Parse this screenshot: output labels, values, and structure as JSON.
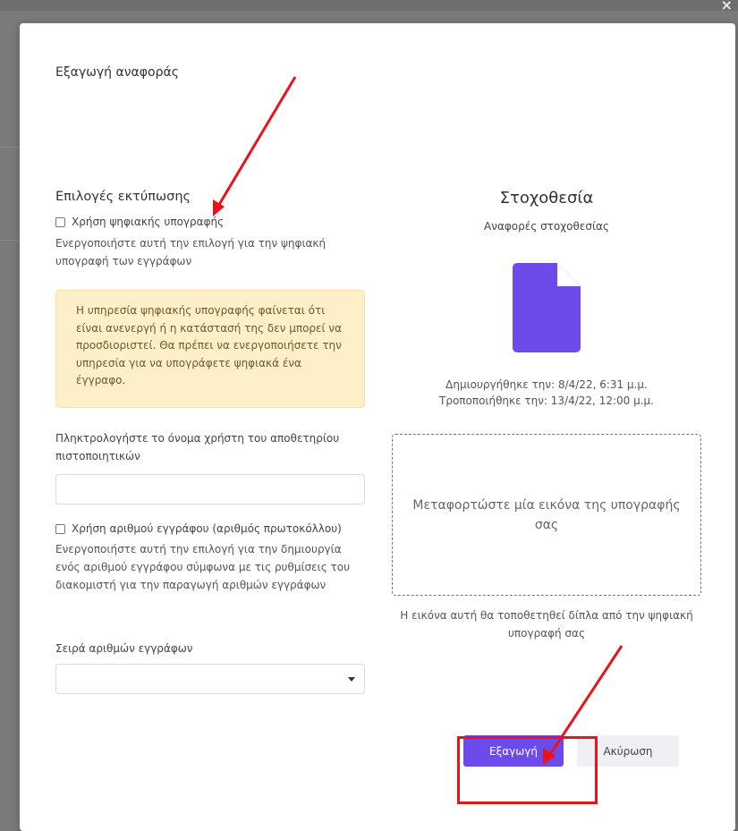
{
  "modal": {
    "title": "Εξαγωγή αναφοράς",
    "close_glyph": "×"
  },
  "print_options": {
    "section_title": "Επιλογές εκτύπωσης",
    "digital_signature": {
      "label": "Χρήση ψηφιακής υπογραφής",
      "checked": false,
      "help": "Ενεργοποιήστε αυτή την επιλογή για την ψηφιακή υπογραφή των εγγράφων"
    },
    "warning": "Η υπηρεσία ψηφιακής υπογραφής φαίνεται ότι είναι ανενεργή ή η κατάστασή της δεν μπορεί να προσδιοριστεί. Θα πρέπει να ενεργοποιήσετε την υπηρεσία για να υπογράφετε ψηφιακά ένα έγγραφο.",
    "keystore_user": {
      "label": "Πληκτρολογήστε το όνομα χρήστη του αποθετηρίου πιστοποιητικών",
      "value": ""
    },
    "document_number": {
      "label": "Χρήση αριθμού εγγράφου (αριθμός πρωτοκόλλου)",
      "checked": false,
      "help": "Ενεργοποιήστε αυτή την επιλογή για την δημιουργία ενός αριθμού εγγράφου σύμφωνα με τις ρυθμίσεις του διακομιστή για την παραγωγή αριθμών εγγράφων"
    },
    "number_series": {
      "label": "Σειρά αριθμών εγγράφων",
      "selected": ""
    }
  },
  "report": {
    "title": "Στοχοθεσία",
    "subtitle": "Αναφορές στοχοθεσίας",
    "icon": "document-icon",
    "created": "Δημιουργήθηκε την: 8/4/22, 6:31 μ.μ.",
    "modified": "Τροποποιήθηκε την: 13/4/22, 12:00 μ.μ."
  },
  "signature_upload": {
    "prompt": "Μεταφορτώστε μία εικόνα της υπογραφής σας",
    "note": "Η εικόνα αυτή θα τοποθετηθεί δίπλα από την ψηφιακή υπογραφή σας"
  },
  "actions": {
    "export_label": "Εξαγωγή",
    "cancel_label": "Ακύρωση"
  },
  "colors": {
    "primary": "#6c4bea",
    "annotation": "#e8141a",
    "warning_bg": "#fdf0c8"
  }
}
